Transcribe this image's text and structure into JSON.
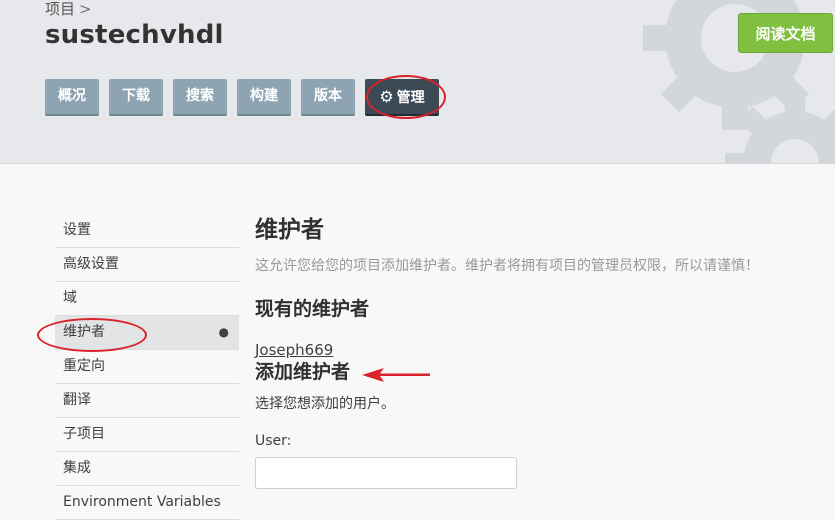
{
  "header": {
    "breadcrumb": "项目",
    "breadcrumb_sep": ">",
    "project_title": "sustechvhdl",
    "read_docs_label": "阅读文档"
  },
  "nav": {
    "overview": "概况",
    "downloads": "下载",
    "search": "搜索",
    "builds": "构建",
    "versions": "版本",
    "admin": "管理",
    "admin_icon": "gear-icon"
  },
  "sidebar": {
    "items": [
      {
        "label": "设置"
      },
      {
        "label": "高级设置"
      },
      {
        "label": "域"
      },
      {
        "label": "维护者",
        "active": true
      },
      {
        "label": "重定向"
      },
      {
        "label": "翻译"
      },
      {
        "label": "子项目"
      },
      {
        "label": "集成"
      },
      {
        "label": "Environment Variables"
      }
    ],
    "active_marker": "●"
  },
  "main": {
    "title": "维护者",
    "description": "这允许您给您的项目添加维护者。维护者将拥有项目的管理员权限，所以请谨慎！",
    "existing_heading": "现有的维护者",
    "maintainer": "Joseph669",
    "add_heading": "添加维护者",
    "choose_user_text": "选择您想添加的用户。",
    "user_label": "User:",
    "user_value": ""
  },
  "colors": {
    "accent_green": "#80c040",
    "nav_button": "#8fa4b2",
    "nav_active": "#3b4a55",
    "annotation_red": "#d9222a"
  }
}
